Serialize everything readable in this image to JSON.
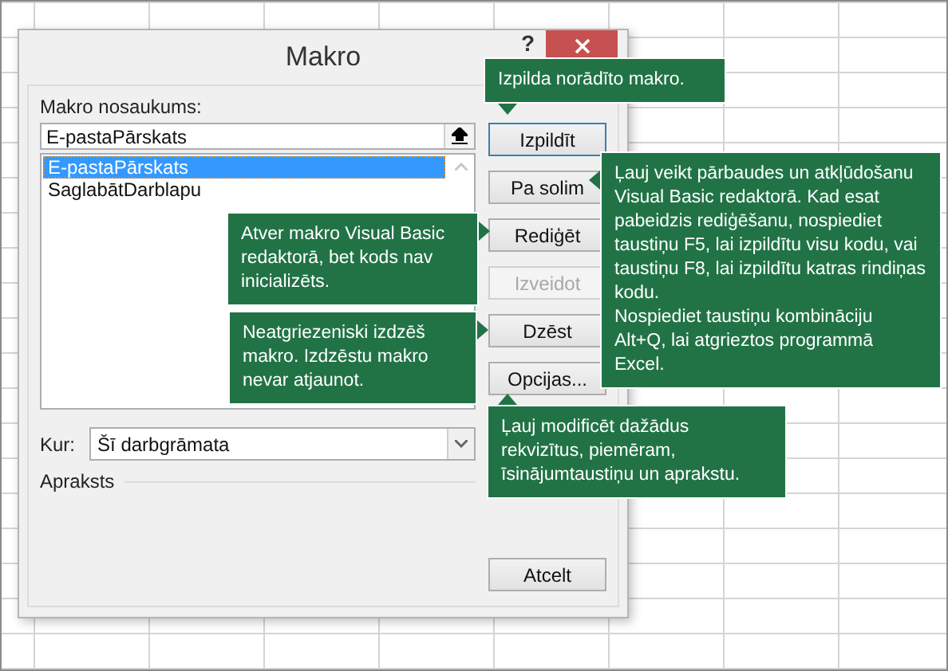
{
  "window": {
    "title": "Makro",
    "help": "?"
  },
  "macro_name": {
    "label": "Makro nosaukums:",
    "value": "E-pastaPārskats"
  },
  "macros": [
    {
      "name": "E-pastaPārskats",
      "selected": true
    },
    {
      "name": "SaglabātDarblapu",
      "selected": false
    }
  ],
  "buttons": [
    {
      "label": "Izpildīt",
      "disabled": false,
      "focused": true
    },
    {
      "label": "Pa solim",
      "disabled": false,
      "focused": false
    },
    {
      "label": "Rediģēt",
      "disabled": false,
      "focused": false
    },
    {
      "label": "Izveidot",
      "disabled": true,
      "focused": false
    },
    {
      "label": "Dzēst",
      "disabled": false,
      "focused": false
    },
    {
      "label": "Opcijas...",
      "disabled": false,
      "focused": false
    }
  ],
  "location": {
    "label": "Kur:",
    "value": "Šī darbgrāmata"
  },
  "description": {
    "label": "Apraksts"
  },
  "cancel": "Atcelt",
  "callouts": [
    {
      "paragraphs": [
        "Izpilda norādīto makro."
      ]
    },
    {
      "paragraphs": [
        "Ļauj veikt pārbaudes un atkļūdošanu Visual Basic redaktorā. Kad esat pabeidzis rediģēšanu, nospiediet taustiņu F5, lai izpildītu visu kodu, vai taustiņu F8, lai izpildītu katras rindiņas kodu.",
        "Nospiediet taustiņu kombināciju Alt+Q, lai atgrieztos programmā Excel."
      ]
    },
    {
      "paragraphs": [
        "Atver makro Visual Basic redaktorā, bet kods nav inicializēts."
      ]
    },
    {
      "paragraphs": [
        "Neatgriezeniski izdzēš makro. Izdzēstu makro nevar atjaunot."
      ]
    },
    {
      "paragraphs": [
        "Ļauj modificēt dažādus rekvizītus, piemēram, īsinājumtaustiņu un aprakstu."
      ]
    }
  ]
}
